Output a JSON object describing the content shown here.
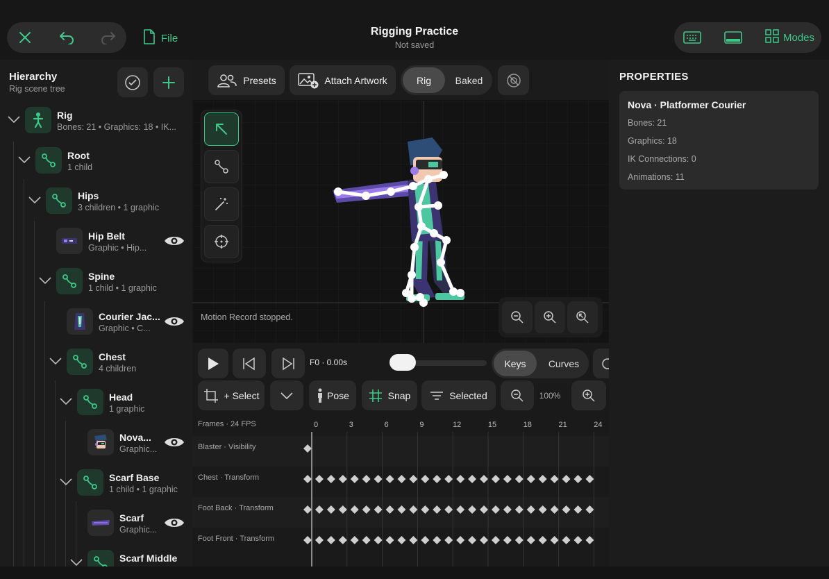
{
  "header": {
    "title": "Rigging Practice",
    "subtitle": "Not saved",
    "file_label": "File",
    "modes_label": "Modes"
  },
  "hierarchy": {
    "title": "Hierarchy",
    "subtitle": "Rig scene tree",
    "rows": [
      {
        "name": "Rig",
        "sub": "Bones: 21  •  Graphics: 18  •  IK..."
      },
      {
        "name": "Root",
        "sub": "1 child"
      },
      {
        "name": "Hips",
        "sub": "3 children  •  1 graphic"
      },
      {
        "name": "Hip Belt",
        "sub": "Graphic  •  Hip..."
      },
      {
        "name": "Spine",
        "sub": "1 child  •  1 graphic"
      },
      {
        "name": "Courier Jac...",
        "sub": "Graphic  •  C..."
      },
      {
        "name": "Chest",
        "sub": "4 children"
      },
      {
        "name": "Head",
        "sub": "1 graphic"
      },
      {
        "name": "Nova...",
        "sub": "Graphic..."
      },
      {
        "name": "Scarf Base",
        "sub": "1 child  •  1 graphic"
      },
      {
        "name": "Scarf",
        "sub": "Graphic..."
      },
      {
        "name": "Scarf Middle",
        "sub": ""
      }
    ]
  },
  "toolbar": {
    "presets": "Presets",
    "attach": "Attach Artwork",
    "rig": "Rig",
    "baked": "Baked"
  },
  "viewport": {
    "status": "Motion Record stopped."
  },
  "transport": {
    "frame_readout": "F0 · 0.00s",
    "keys": "Keys",
    "curves": "Curves",
    "select": "+ Select",
    "pose": "Pose",
    "snap": "Snap",
    "selected": "Selected",
    "zoom": "100%"
  },
  "timeline": {
    "header": "Frames · 24 FPS",
    "ticks": [
      "0",
      "3",
      "6",
      "9",
      "12",
      "15",
      "18",
      "21",
      "24"
    ],
    "tracks": [
      {
        "label": "Blaster · Visibility",
        "keyframes": [
          0
        ]
      },
      {
        "label": "Chest · Transform",
        "keyframes": "every frame 0–24"
      },
      {
        "label": "Foot Back · Transform",
        "keyframes": "every frame 0–24"
      },
      {
        "label": "Foot Front · Transform",
        "keyframes": "every frame 0–24"
      }
    ]
  },
  "properties": {
    "title": "PROPERTIES",
    "card_title": "Nova · Platformer Courier",
    "bones": "Bones: 21",
    "graphics": "Graphics: 18",
    "ik": "IK Connections: 0",
    "animations": "Animations: 11"
  },
  "colors": {
    "accent": "#3ec98a",
    "background": "#161616",
    "panel": "#1c1c1c"
  }
}
